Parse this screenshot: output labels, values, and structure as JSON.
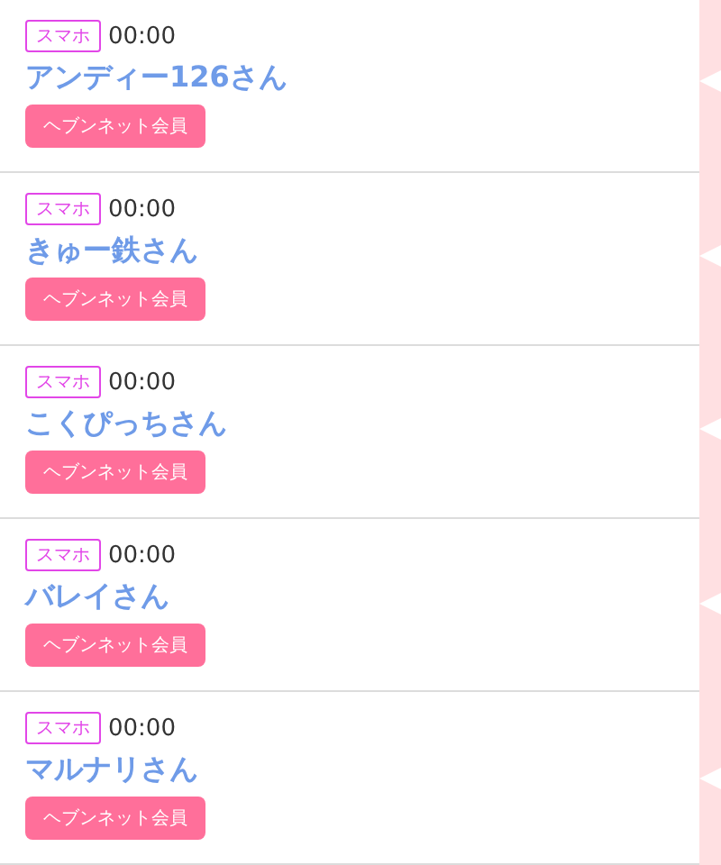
{
  "entries": [
    {
      "device": "スマホ",
      "time": "00:00",
      "name": "アンディー126さん",
      "badge": "ヘブンネット会員"
    },
    {
      "device": "スマホ",
      "time": "00:00",
      "name": "きゅー鉄さん",
      "badge": "ヘブンネット会員"
    },
    {
      "device": "スマホ",
      "time": "00:00",
      "name": "こくぴっちさん",
      "badge": "ヘブンネット会員"
    },
    {
      "device": "スマホ",
      "time": "00:00",
      "name": "バレイさん",
      "badge": "ヘブンネット会員"
    },
    {
      "device": "スマホ",
      "time": "00:00",
      "name": "マルナリさん",
      "badge": "ヘブンネット会員"
    }
  ]
}
